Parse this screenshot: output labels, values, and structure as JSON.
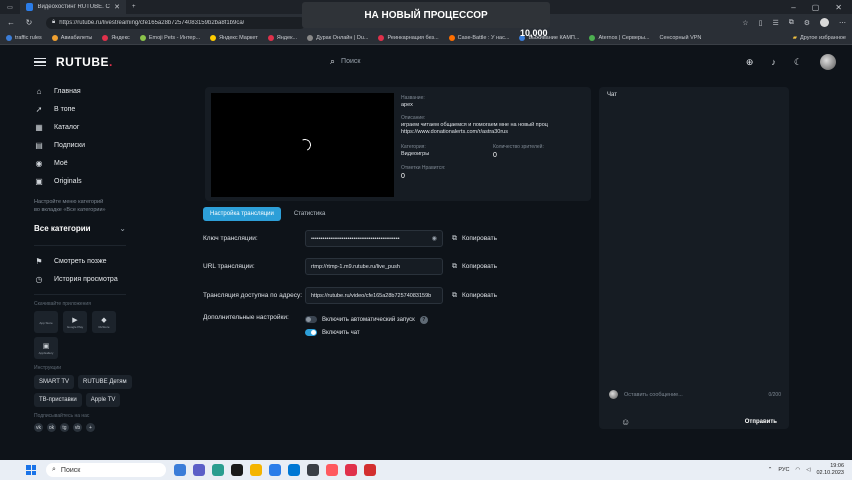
{
  "browser": {
    "tab_title": "Видеохостинг RUTUBE. Смотр...",
    "tab_close": "✕",
    "new_tab": "+",
    "url": "https://rutube.ru/livestreaming/cfe165a28b72574083159b2ba8f1b9ca/",
    "window_controls": [
      "–",
      "▢",
      "✕"
    ]
  },
  "banner": "НА НОВЫЙ ПРОЦЕССОР",
  "bookmark_counter": "10,000",
  "bookmarks": [
    {
      "label": "traffic rules",
      "color": "#3b7dd8"
    },
    {
      "label": "Авиабилеты",
      "color": "#f0a030"
    },
    {
      "label": "Яндекс",
      "color": "#e0314b"
    },
    {
      "label": "Emoji Pets - Интер...",
      "color": "#8bc34a"
    },
    {
      "label": "Яндекс Маркет",
      "color": "#ffcc00"
    },
    {
      "label": "Яндек...",
      "color": "#e0314b"
    },
    {
      "label": "Дурак Онлайн | Du...",
      "color": "#888888"
    },
    {
      "label": "Реинкарнация без...",
      "color": "#e0314b"
    },
    {
      "label": "Case-Battle : У нас...",
      "color": "#ff6f00"
    },
    {
      "label": "Выживание КАМП...",
      "color": "#3b7dd8"
    },
    {
      "label": "Aternos | Серверы...",
      "color": "#4caf50"
    },
    {
      "label": "Сенсорный VPN",
      "color": "#2a2f36"
    }
  ],
  "bookmarks_other": "Другое избранное",
  "header": {
    "logo_main": "RUTUBE",
    "search_placeholder": "Поиск"
  },
  "sidebar": {
    "nav": [
      {
        "icon": "⌂",
        "label": "Главная"
      },
      {
        "icon": "➚",
        "label": "В топе"
      },
      {
        "icon": "▦",
        "label": "Каталог"
      },
      {
        "icon": "▤",
        "label": "Подписки"
      },
      {
        "icon": "◉",
        "label": "Моё"
      },
      {
        "icon": "▣",
        "label": "Originals"
      }
    ],
    "note": "Настройте меню категорий во вкладке «Все категории»",
    "all_categories": "Все категории",
    "secondary": [
      {
        "icon": "⚑",
        "label": "Смотреть позже"
      },
      {
        "icon": "◷",
        "label": "История просмотра"
      }
    ],
    "apps_label": "Скачивайте приложения",
    "apps": [
      {
        "icon": "",
        "caption": "App Store"
      },
      {
        "icon": "▶",
        "caption": "Google Play"
      },
      {
        "icon": "◆",
        "caption": "RuStore"
      },
      {
        "icon": "▣",
        "caption": "AppGallery"
      }
    ],
    "tools_label": "Инструкции",
    "chips": [
      "SMART TV",
      "RUTUBE Детям",
      "ТВ-приставки",
      "Apple TV"
    ],
    "social_label": "Подписывайтесь на нас",
    "socials": [
      "vk",
      "ok",
      "tg",
      "vb",
      "+"
    ]
  },
  "stream": {
    "name_label": "Название:",
    "name_value": "apex",
    "desc_label": "Описание:",
    "desc_value": "играем читаем общаемся и помогаем мне на новый проц https://www.donationalerts.com/r/astra30rus",
    "category_label": "Категория:",
    "category_value": "Видеоигры",
    "viewers_label": "Количество зрителей:",
    "viewers_value": "0",
    "likes_label": "Отметки Нравится:",
    "likes_value": "0"
  },
  "tabs": {
    "settings": "Настройка трансляции",
    "stats": "Статистика"
  },
  "form": {
    "key_label": "Ключ трансляции:",
    "key_value": "••••••••••••••••••••••••••••••••••••••••••••••",
    "url_label": "URL трансляции:",
    "url_value": "rtmp://rtmp-1.m9.rutube.ru/live_push",
    "addr_label": "Трансляция доступна по адресу:",
    "addr_value": "https://rutube.ru/video/cfe165a28b72574083159b",
    "copy": "Копировать",
    "extra_label": "Дополнительные настройки:",
    "autostart": "Включить автоматический запуск",
    "chat_toggle": "Включить чат"
  },
  "chat": {
    "title": "Чат",
    "placeholder": "Оставить сообщение...",
    "counter": "0/200",
    "send": "Отправить"
  },
  "taskbar": {
    "search": "Поиск",
    "lang": "РУС",
    "time": "19:06",
    "date": "02.10.2023",
    "apps": [
      "#3b7dd8",
      "#5b5fc7",
      "#2a9d8f",
      "#1a1a1a",
      "#f4b400",
      "#2b7de9",
      "#0078d4",
      "#3a3f46",
      "#ff5a5f",
      "#e0314b",
      "#d32f2f"
    ]
  }
}
